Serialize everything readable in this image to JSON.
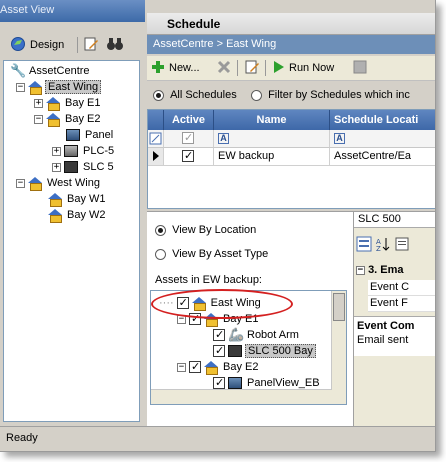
{
  "left": {
    "title": "Asset View",
    "toolbar": {
      "design_label": "Design"
    },
    "tree": [
      {
        "label": "AssetCentre",
        "icon": "wrench-icon"
      },
      {
        "label": "East Wing",
        "icon": "house-icon",
        "selected": true
      },
      {
        "label": "Bay E1",
        "icon": "house-icon"
      },
      {
        "label": "Bay E2",
        "icon": "house-icon"
      },
      {
        "label": "Panel",
        "icon": "device-icon"
      },
      {
        "label": "PLC-5",
        "icon": "device-icon"
      },
      {
        "label": "SLC 5",
        "icon": "device-icon"
      },
      {
        "label": "West Wing",
        "icon": "house-icon"
      },
      {
        "label": "Bay W1",
        "icon": "house-icon"
      },
      {
        "label": "Bay W2",
        "icon": "house-icon"
      }
    ]
  },
  "schedule": {
    "title": "Schedule",
    "breadcrumb": "AssetCentre >  East Wing",
    "toolbar": {
      "new_label": "New...",
      "run_label": "Run Now"
    },
    "filter": {
      "all_label": "All Schedules",
      "filter_label": "Filter by Schedules which inc"
    },
    "grid": {
      "headers": [
        "Active",
        "Name",
        "Schedule Locati"
      ],
      "filter_glyph": "A",
      "rows": [
        {
          "active": true,
          "name": "EW backup",
          "location": "AssetCentre/Ea"
        }
      ]
    }
  },
  "details": {
    "view_by_location": "View By Location",
    "view_by_asset_type": "View By Asset Type",
    "assets_label": "Assets in EW backup:",
    "asset_tree": [
      {
        "label": "East Wing",
        "checked": true
      },
      {
        "label": "Bay E1",
        "checked": true
      },
      {
        "label": "Robot Arm",
        "checked": true
      },
      {
        "label": "SLC 500 Bay",
        "checked": true
      },
      {
        "label": "Bay E2",
        "checked": true
      },
      {
        "label": "PanelView_EB",
        "checked": true
      }
    ]
  },
  "properties": {
    "title": "SLC 500",
    "section": "3. Ema",
    "rows": [
      "Event C",
      "Event F"
    ],
    "desc_title": "Event Com",
    "desc_text": "Email sent "
  },
  "status": "Ready",
  "colors": {
    "title_bar": "#3d6aa8",
    "grid_header": "#5f86c0",
    "highlight": "#d42020"
  }
}
